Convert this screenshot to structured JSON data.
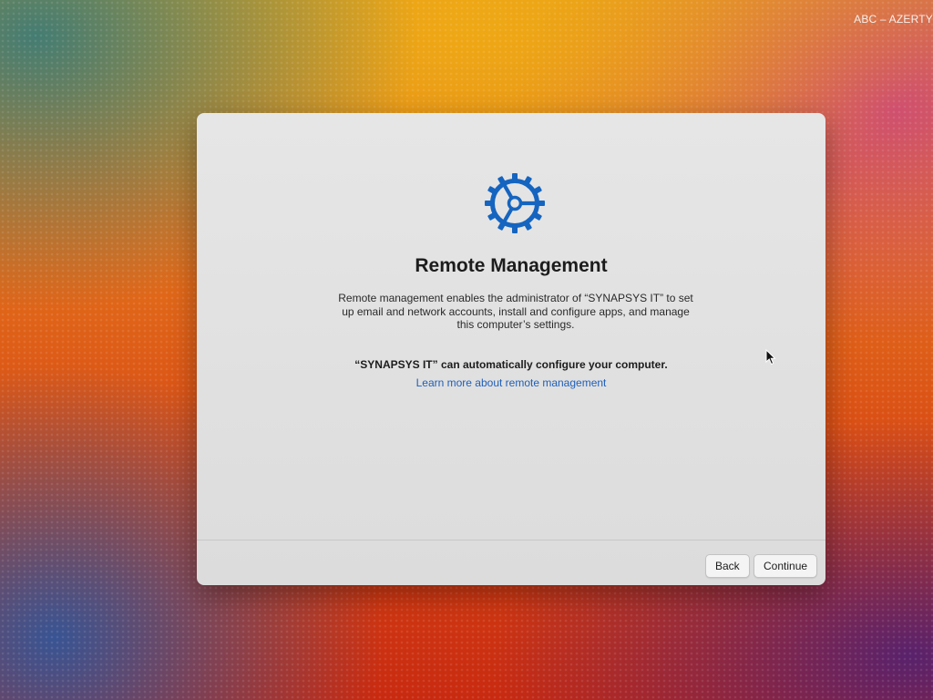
{
  "menubar": {
    "input_source": "ABC – AZERTY"
  },
  "dialog": {
    "icon": "gear-icon",
    "title": "Remote Management",
    "description": "Remote management enables the administrator of “SYNAPSYS IT” to set up email and network accounts, install and configure apps, and manage this computer’s settings.",
    "auto_config_text": "“SYNAPSYS IT” can automatically configure your computer.",
    "learn_more_link": "Learn more about remote management",
    "back_label": "Back",
    "continue_label": "Continue"
  },
  "colors": {
    "accent": "#1f5fb8",
    "gear": "#1565c0",
    "window_bg": "#e3e3e3"
  }
}
